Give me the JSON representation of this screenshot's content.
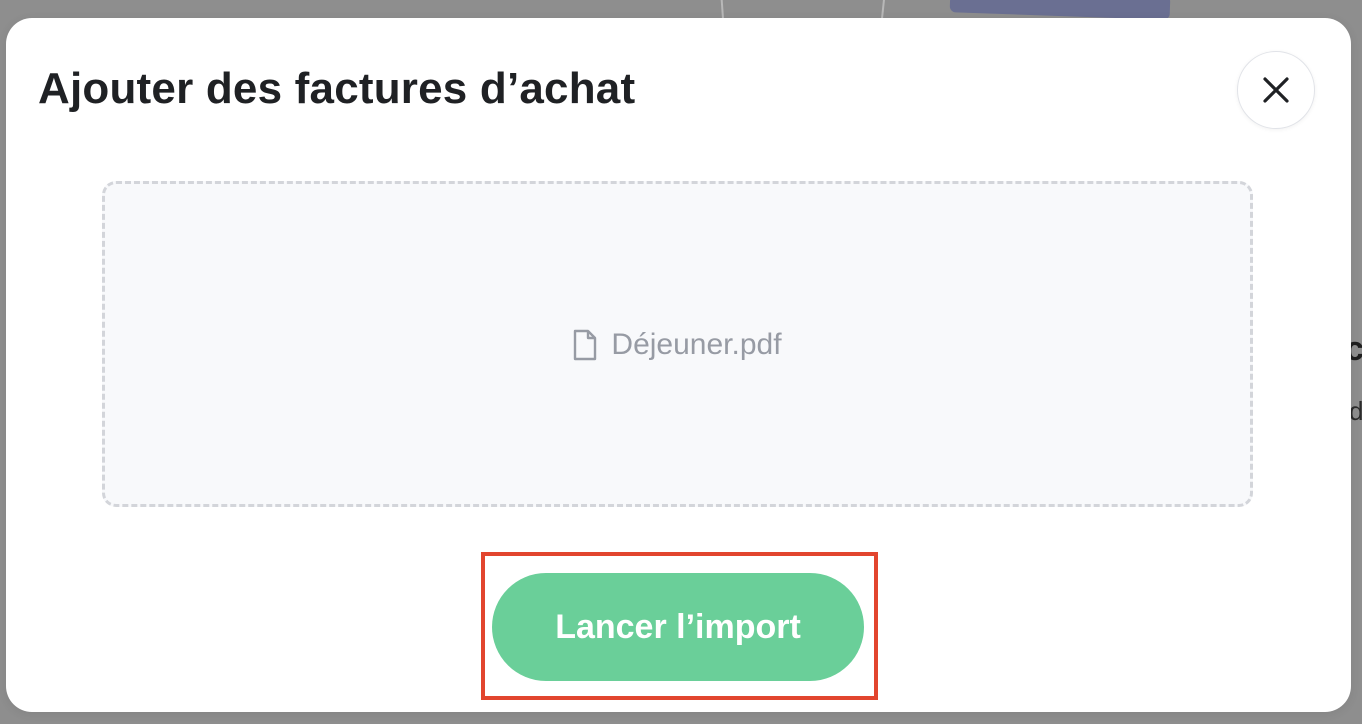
{
  "modal": {
    "title": "Ajouter des factures d’achat",
    "close_icon": "close-icon"
  },
  "dropzone": {
    "file_icon": "file-icon",
    "file_name": "Déjeuner.pdf"
  },
  "actions": {
    "import_label": "Lancer l’import"
  },
  "background": {
    "partial_text_1": "c",
    "partial_text_2": "d"
  },
  "colors": {
    "primary_button": "#6acf99",
    "highlight": "#e2452e",
    "overlay": "#8e8e8e"
  }
}
